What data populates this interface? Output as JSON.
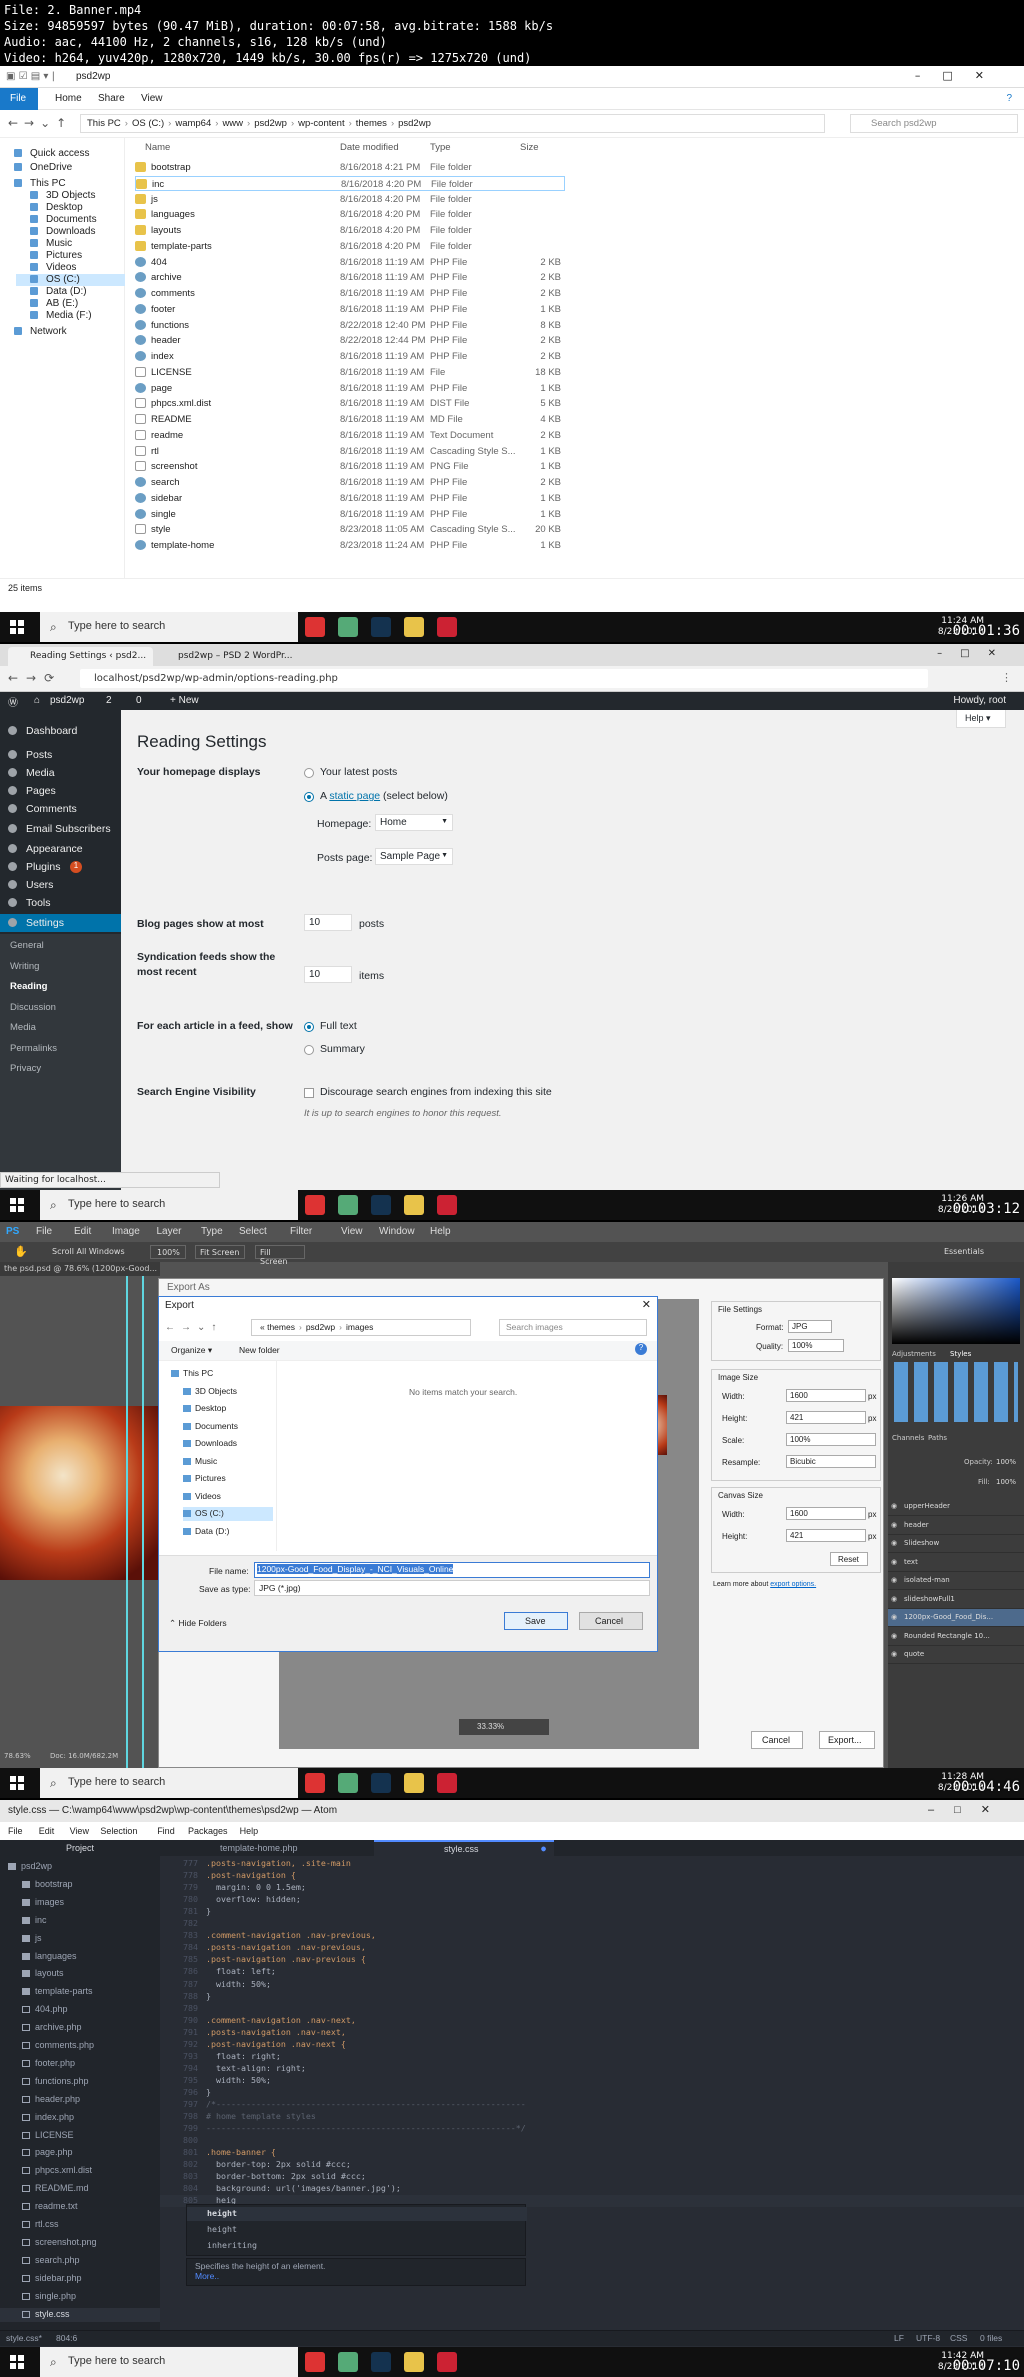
{
  "header": {
    "lines": [
      "File: 2. Banner.mp4",
      "Size: 94859597 bytes (90.47 MiB), duration: 00:07:58, avg.bitrate: 1588 kb/s",
      "Audio: aac, 44100 Hz, 2 channels, s16, 128 kb/s (und)",
      "Video: h264, yuv420p, 1280x720, 1449 kb/s, 30.00 fps(r) => 1275x720 (und)"
    ]
  },
  "taskbar": {
    "search": "Type here to search"
  },
  "explorer": {
    "title": "psd2wp",
    "ribbon": [
      "File",
      "Home",
      "Share",
      "View"
    ],
    "breadcrumb": [
      "This PC",
      "OS (C:)",
      "wamp64",
      "www",
      "psd2wp",
      "wp-content",
      "themes",
      "psd2wp"
    ],
    "search_placeholder": "Search psd2wp",
    "nav": [
      "Quick access",
      "OneDrive",
      "This PC",
      "3D Objects",
      "Desktop",
      "Documents",
      "Downloads",
      "Music",
      "Pictures",
      "Videos",
      "OS (C:)",
      "Data (D:)",
      "AB (E:)",
      "Media (F:)",
      "Network"
    ],
    "columns": [
      "Name",
      "Date modified",
      "Type",
      "Size"
    ],
    "files": [
      {
        "name": "bootstrap",
        "date": "8/16/2018 4:21 PM",
        "type": "File folder",
        "size": "",
        "k": "fold"
      },
      {
        "name": "inc",
        "date": "8/16/2018 4:20 PM",
        "type": "File folder",
        "size": "",
        "k": "fold"
      },
      {
        "name": "js",
        "date": "8/16/2018 4:20 PM",
        "type": "File folder",
        "size": "",
        "k": "fold"
      },
      {
        "name": "languages",
        "date": "8/16/2018 4:20 PM",
        "type": "File folder",
        "size": "",
        "k": "fold"
      },
      {
        "name": "layouts",
        "date": "8/16/2018 4:20 PM",
        "type": "File folder",
        "size": "",
        "k": "fold"
      },
      {
        "name": "template-parts",
        "date": "8/16/2018 4:20 PM",
        "type": "File folder",
        "size": "",
        "k": "fold"
      },
      {
        "name": "404",
        "date": "8/16/2018 11:19 AM",
        "type": "PHP File",
        "size": "2 KB",
        "k": "php"
      },
      {
        "name": "archive",
        "date": "8/16/2018 11:19 AM",
        "type": "PHP File",
        "size": "2 KB",
        "k": "php"
      },
      {
        "name": "comments",
        "date": "8/16/2018 11:19 AM",
        "type": "PHP File",
        "size": "2 KB",
        "k": "php"
      },
      {
        "name": "footer",
        "date": "8/16/2018 11:19 AM",
        "type": "PHP File",
        "size": "1 KB",
        "k": "php"
      },
      {
        "name": "functions",
        "date": "8/22/2018 12:40 PM",
        "type": "PHP File",
        "size": "8 KB",
        "k": "php"
      },
      {
        "name": "header",
        "date": "8/22/2018 12:44 PM",
        "type": "PHP File",
        "size": "2 KB",
        "k": "php"
      },
      {
        "name": "index",
        "date": "8/16/2018 11:19 AM",
        "type": "PHP File",
        "size": "2 KB",
        "k": "php"
      },
      {
        "name": "LICENSE",
        "date": "8/16/2018 11:19 AM",
        "type": "File",
        "size": "18 KB",
        "k": "doc"
      },
      {
        "name": "page",
        "date": "8/16/2018 11:19 AM",
        "type": "PHP File",
        "size": "1 KB",
        "k": "php"
      },
      {
        "name": "phpcs.xml.dist",
        "date": "8/16/2018 11:19 AM",
        "type": "DIST File",
        "size": "5 KB",
        "k": "doc"
      },
      {
        "name": "README",
        "date": "8/16/2018 11:19 AM",
        "type": "MD File",
        "size": "4 KB",
        "k": "doc"
      },
      {
        "name": "readme",
        "date": "8/16/2018 11:19 AM",
        "type": "Text Document",
        "size": "2 KB",
        "k": "doc"
      },
      {
        "name": "rtl",
        "date": "8/16/2018 11:19 AM",
        "type": "Cascading Style S...",
        "size": "1 KB",
        "k": "doc"
      },
      {
        "name": "screenshot",
        "date": "8/16/2018 11:19 AM",
        "type": "PNG File",
        "size": "1 KB",
        "k": "doc"
      },
      {
        "name": "search",
        "date": "8/16/2018 11:19 AM",
        "type": "PHP File",
        "size": "2 KB",
        "k": "php"
      },
      {
        "name": "sidebar",
        "date": "8/16/2018 11:19 AM",
        "type": "PHP File",
        "size": "1 KB",
        "k": "php"
      },
      {
        "name": "single",
        "date": "8/16/2018 11:19 AM",
        "type": "PHP File",
        "size": "1 KB",
        "k": "php"
      },
      {
        "name": "style",
        "date": "8/23/2018 11:05 AM",
        "type": "Cascading Style S...",
        "size": "20 KB",
        "k": "doc"
      },
      {
        "name": "template-home",
        "date": "8/23/2018 11:24 AM",
        "type": "PHP File",
        "size": "1 KB",
        "k": "php"
      }
    ],
    "status": "25 items",
    "clock": {
      "time": "11:24 AM",
      "date": "8/23/2018"
    },
    "timestamp": "00:01:36"
  },
  "wp": {
    "tabs": [
      "Reading Settings ‹ psd2...",
      "psd2wp – PSD 2 WordPr..."
    ],
    "url": "localhost/psd2wp/wp-admin/options-reading.php",
    "adminbar": {
      "site": "psd2wp",
      "comments": "2",
      "updates": "0",
      "new": "+ New",
      "howdy": "Howdy, root"
    },
    "menu": [
      "Dashboard",
      "Posts",
      "Media",
      "Pages",
      "Comments",
      "Email Subscribers",
      "Appearance",
      "Plugins",
      "Users",
      "Tools",
      "Settings"
    ],
    "plugins_badge": "1",
    "submenu": [
      "General",
      "Writing",
      "Reading",
      "Discussion",
      "Media",
      "Permalinks",
      "Privacy"
    ],
    "title": "Reading Settings",
    "help": "Help ▾",
    "homepage_label": "Your homepage displays",
    "opt_latest": "Your latest posts",
    "opt_static_a": "A ",
    "opt_static_link": "static page",
    "opt_static_b": " (select below)",
    "homepage_sel_label": "Homepage:",
    "homepage_sel": "Home",
    "postspage_label": "Posts page:",
    "postspage_sel": "Sample Page",
    "blog_label": "Blog pages show at most",
    "blog_val": "10",
    "blog_unit": "posts",
    "synd_label": "Syndication feeds show the most recent",
    "synd_val": "10",
    "synd_unit": "items",
    "feed_label": "For each article in a feed, show",
    "feed_full": "Full text",
    "feed_summary": "Summary",
    "seo_label": "Search Engine Visibility",
    "seo_cb": "Discourage search engines from indexing this site",
    "seo_note": "It is up to search engines to honor this request.",
    "status": "Waiting for localhost...",
    "clock": {
      "time": "11:26 AM",
      "date": "8/23/2018"
    },
    "timestamp": "00:03:12"
  },
  "ps": {
    "menu": [
      "PS",
      "File",
      "Edit",
      "Image",
      "Layer",
      "Type",
      "Select",
      "Filter",
      "View",
      "Window",
      "Help"
    ],
    "opts": [
      "Scroll All Windows",
      "100%",
      "Fit Screen",
      "Fill Screen"
    ],
    "essentials": "Essentials",
    "doc_tab": "the psd.psd @ 78.6% (1200px-Good...",
    "export_as": "Export As",
    "dialog": {
      "title": "Export",
      "path": [
        "themes",
        "psd2wp",
        "images"
      ],
      "search": "Search images",
      "organize": "Organize ▾",
      "new_folder": "New folder",
      "empty": "No items match your search.",
      "tree": [
        "This PC",
        "3D Objects",
        "Desktop",
        "Documents",
        "Downloads",
        "Music",
        "Pictures",
        "Videos",
        "OS (C:)",
        "Data (D:)"
      ],
      "filename_label": "File name:",
      "filename": "1200px-Good_Food_Display_-_NCI_Visuals_Online",
      "type_label": "Save as type:",
      "type": "JPG (*.jpg)",
      "hide": "Hide Folders",
      "save": "Save",
      "cancel": "Cancel"
    },
    "settings": {
      "file_settings": "File Settings",
      "format_label": "Format:",
      "format": "JPG",
      "quality_label": "Quality:",
      "quality": "100%",
      "image_size": "Image Size",
      "width_label": "Width:",
      "width": "1600",
      "height_label": "Height:",
      "height": "421",
      "scale_label": "Scale:",
      "scale": "100%",
      "resample_label": "Resample:",
      "resample": "Bicubic",
      "canvas_size": "Canvas Size",
      "cwidth": "1600",
      "cheight": "421",
      "reset": "Reset",
      "px": "px",
      "learn": "Learn more about ",
      "learn_link": "export options.",
      "cancel": "Cancel",
      "export": "Export...",
      "zoom": "33.33%"
    },
    "panels": {
      "tabs": [
        "Adjustments",
        "Styles"
      ],
      "layers_tabs": [
        "Channels",
        "Paths"
      ],
      "opacity_label": "Opacity:",
      "opacity": "100%",
      "fill_label": "Fill:",
      "fill": "100%",
      "layers": [
        "upperHeader",
        "header",
        "Slideshow",
        "text",
        "isolated-man",
        "slideshowFull1",
        "1200px-Good_Food_Dis...",
        "Rounded Rectangle 10...",
        "quote"
      ]
    },
    "status": "Doc: 16.0M/682.2M",
    "zoom": "78.63%",
    "clock": {
      "time": "11:28 AM",
      "date": "8/23/2018"
    },
    "timestamp": "00:04:46"
  },
  "atom": {
    "title": "style.css — C:\\wamp64\\www\\psd2wp\\wp-content\\themes\\psd2wp — Atom",
    "menu": [
      "File",
      "Edit",
      "View",
      "Selection",
      "Find",
      "Packages",
      "Help"
    ],
    "project": "Project",
    "tabs": [
      "template-home.php",
      "style.css"
    ],
    "tree": [
      {
        "n": "psd2wp",
        "d": 0,
        "f": 1
      },
      {
        "n": "bootstrap",
        "d": 1,
        "f": 1
      },
      {
        "n": "images",
        "d": 1,
        "f": 1
      },
      {
        "n": "inc",
        "d": 1,
        "f": 1
      },
      {
        "n": "js",
        "d": 1,
        "f": 1
      },
      {
        "n": "languages",
        "d": 1,
        "f": 1
      },
      {
        "n": "layouts",
        "d": 1,
        "f": 1
      },
      {
        "n": "template-parts",
        "d": 1,
        "f": 1
      },
      {
        "n": "404.php",
        "d": 1,
        "f": 0
      },
      {
        "n": "archive.php",
        "d": 1,
        "f": 0
      },
      {
        "n": "comments.php",
        "d": 1,
        "f": 0
      },
      {
        "n": "footer.php",
        "d": 1,
        "f": 0
      },
      {
        "n": "functions.php",
        "d": 1,
        "f": 0
      },
      {
        "n": "header.php",
        "d": 1,
        "f": 0
      },
      {
        "n": "index.php",
        "d": 1,
        "f": 0
      },
      {
        "n": "LICENSE",
        "d": 1,
        "f": 0
      },
      {
        "n": "page.php",
        "d": 1,
        "f": 0
      },
      {
        "n": "phpcs.xml.dist",
        "d": 1,
        "f": 0
      },
      {
        "n": "README.md",
        "d": 1,
        "f": 0
      },
      {
        "n": "readme.txt",
        "d": 1,
        "f": 0
      },
      {
        "n": "rtl.css",
        "d": 1,
        "f": 0
      },
      {
        "n": "screenshot.png",
        "d": 1,
        "f": 0
      },
      {
        "n": "search.php",
        "d": 1,
        "f": 0
      },
      {
        "n": "sidebar.php",
        "d": 1,
        "f": 0
      },
      {
        "n": "single.php",
        "d": 1,
        "f": 0
      },
      {
        "n": "style.css",
        "d": 1,
        "f": 0
      }
    ],
    "code": [
      {
        "n": "777",
        "t": ".posts-navigation, .site-main",
        "c": "#d19a66"
      },
      {
        "n": "778",
        "t": ".post-navigation {",
        "c": "#d19a66"
      },
      {
        "n": "779",
        "t": "  margin: 0 0 1.5em;",
        "c": "#abb2bf"
      },
      {
        "n": "780",
        "t": "  overflow: hidden;",
        "c": "#abb2bf"
      },
      {
        "n": "781",
        "t": "}",
        "c": "#abb2bf"
      },
      {
        "n": "782",
        "t": "",
        "c": "#abb2bf"
      },
      {
        "n": "783",
        "t": ".comment-navigation .nav-previous,",
        "c": "#d19a66"
      },
      {
        "n": "784",
        "t": ".posts-navigation .nav-previous,",
        "c": "#d19a66"
      },
      {
        "n": "785",
        "t": ".post-navigation .nav-previous {",
        "c": "#d19a66"
      },
      {
        "n": "786",
        "t": "  float: left;",
        "c": "#abb2bf"
      },
      {
        "n": "787",
        "t": "  width: 50%;",
        "c": "#abb2bf"
      },
      {
        "n": "788",
        "t": "}",
        "c": "#abb2bf"
      },
      {
        "n": "789",
        "t": "",
        "c": "#abb2bf"
      },
      {
        "n": "790",
        "t": ".comment-navigation .nav-next,",
        "c": "#d19a66"
      },
      {
        "n": "791",
        "t": ".posts-navigation .nav-next,",
        "c": "#d19a66"
      },
      {
        "n": "792",
        "t": ".post-navigation .nav-next {",
        "c": "#d19a66"
      },
      {
        "n": "793",
        "t": "  float: right;",
        "c": "#abb2bf"
      },
      {
        "n": "794",
        "t": "  text-align: right;",
        "c": "#abb2bf"
      },
      {
        "n": "795",
        "t": "  width: 50%;",
        "c": "#abb2bf"
      },
      {
        "n": "796",
        "t": "}",
        "c": "#abb2bf"
      },
      {
        "n": "797",
        "t": "/*--------------------------------------------------------------",
        "c": "#5c6370"
      },
      {
        "n": "798",
        "t": "# home template styles",
        "c": "#5c6370"
      },
      {
        "n": "799",
        "t": "--------------------------------------------------------------*/",
        "c": "#5c6370"
      },
      {
        "n": "800",
        "t": "",
        "c": "#abb2bf"
      },
      {
        "n": "801",
        "t": ".home-banner {",
        "c": "#d19a66"
      },
      {
        "n": "802",
        "t": "  border-top: 2px solid #ccc;",
        "c": "#abb2bf"
      },
      {
        "n": "803",
        "t": "  border-bottom: 2px solid #ccc;",
        "c": "#abb2bf"
      },
      {
        "n": "804",
        "t": "  background: url('images/banner.jpg');",
        "c": "#abb2bf"
      },
      {
        "n": "805",
        "t": "  heig",
        "c": "#abb2bf"
      }
    ],
    "autocomplete": [
      "height",
      "height",
      "inheriting"
    ],
    "tip": "Specifies the height of an element.",
    "more": "More..",
    "status_file": "style.css*",
    "status_pos": "804:6",
    "status_right": [
      "LF",
      "UTF-8",
      "CSS",
      "0 files"
    ],
    "clock": {
      "time": "11:42 AM",
      "date": "8/23/2018"
    },
    "timestamp": "00:07:10"
  },
  "colors": {
    "wp_blue": "#0073aa",
    "atom_bg": "#282c34",
    "ps_bg": "#535353"
  }
}
